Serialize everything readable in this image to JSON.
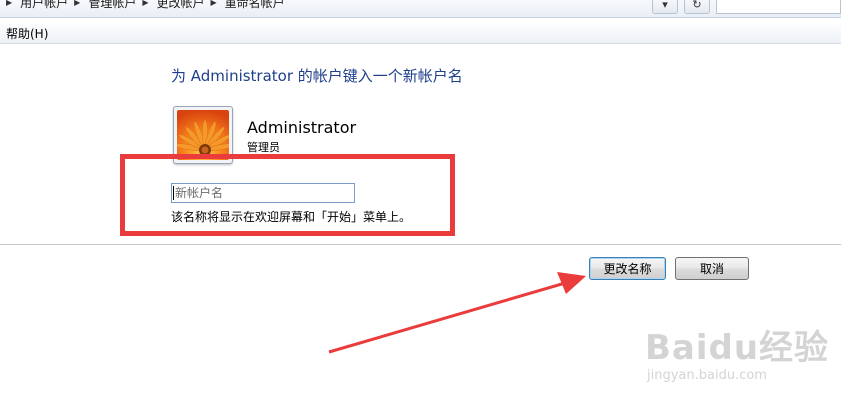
{
  "breadcrumb": [
    "用户帐户",
    "管理帐户",
    "更改帐户",
    "重命名帐户"
  ],
  "menu": {
    "help": "帮助(H)"
  },
  "page": {
    "heading": "为 Administrator 的帐户键入一个新帐户名",
    "user_name": "Administrator",
    "user_role": "管理员",
    "new_name_placeholder": "新帐户名",
    "hint": "该名称将显示在欢迎屏幕和「开始」菜单上。"
  },
  "buttons": {
    "rename": "更改名称",
    "cancel": "取消"
  },
  "watermark": {
    "logo": "Baidu经验",
    "url": "jingyan.baidu.com"
  },
  "colors": {
    "annotation": "#ea3c3c",
    "heading": "#1e3f8a",
    "primary_border": "#3c7fb1"
  }
}
